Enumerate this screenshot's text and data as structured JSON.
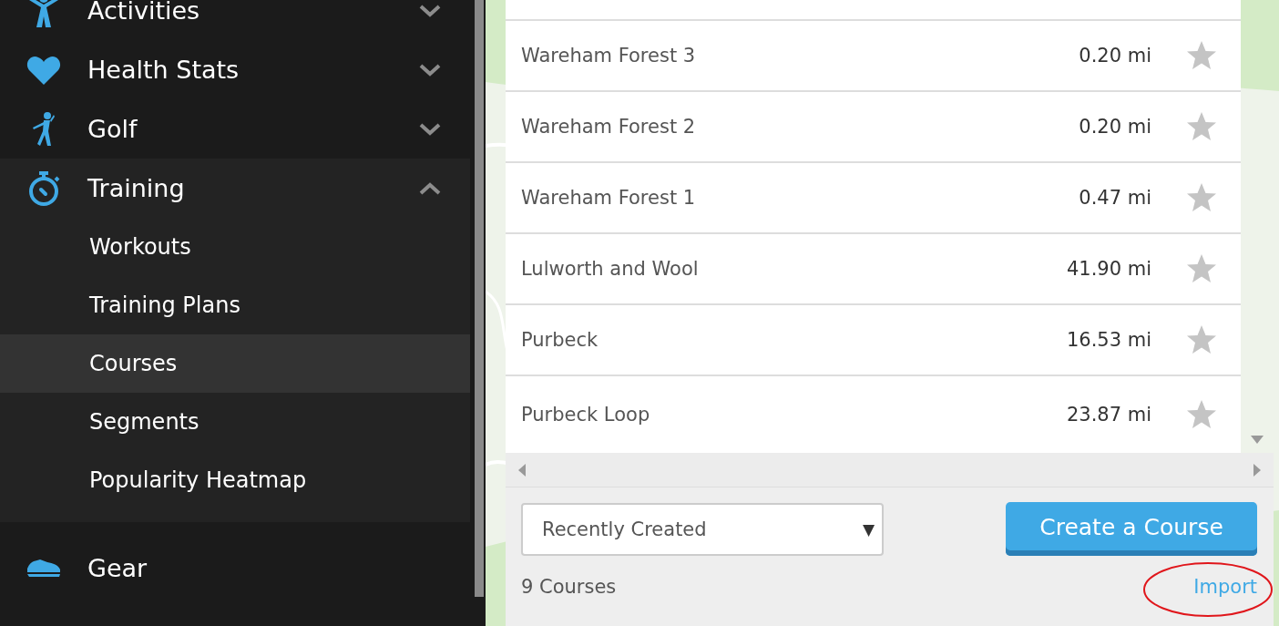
{
  "sidebar": {
    "items": [
      {
        "label": "Activities",
        "expanded": false
      },
      {
        "label": "Health Stats",
        "expanded": false
      },
      {
        "label": "Golf",
        "expanded": false
      },
      {
        "label": "Training",
        "expanded": true,
        "children": [
          {
            "label": "Workouts",
            "selected": false
          },
          {
            "label": "Training Plans",
            "selected": false
          },
          {
            "label": "Courses",
            "selected": true
          },
          {
            "label": "Segments",
            "selected": false
          },
          {
            "label": "Popularity Heatmap",
            "selected": false
          }
        ]
      },
      {
        "label": "Gear"
      }
    ]
  },
  "courses": {
    "rows": [
      {
        "name": "Wareham Forest 3",
        "distance": "0.20 mi",
        "starred": false
      },
      {
        "name": "Wareham Forest 2",
        "distance": "0.20 mi",
        "starred": false
      },
      {
        "name": "Wareham Forest 1",
        "distance": "0.47 mi",
        "starred": false
      },
      {
        "name": "Lulworth and Wool",
        "distance": "41.90 mi",
        "starred": false
      },
      {
        "name": "Purbeck",
        "distance": "16.53 mi",
        "starred": false
      },
      {
        "name": "Purbeck Loop",
        "distance": "23.87 mi",
        "starred": false
      }
    ],
    "sort": {
      "value": "Recently Created",
      "caret": "▼"
    },
    "create_button": "Create a Course",
    "count": "9 Courses",
    "import_link": {
      "label": "Import",
      "highlighted": true
    }
  }
}
